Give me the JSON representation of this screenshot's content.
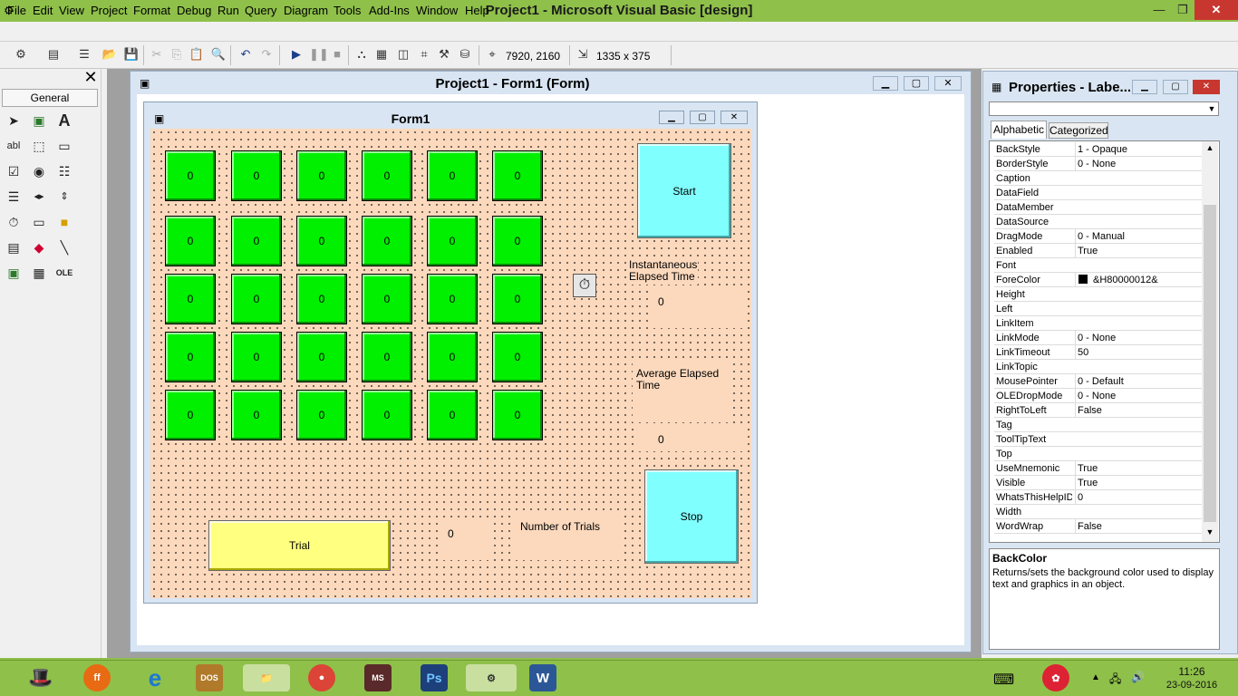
{
  "window": {
    "title": "Project1 - Microsoft Visual Basic [design]"
  },
  "menu": [
    "File",
    "Edit",
    "View",
    "Project",
    "Format",
    "Debug",
    "Run",
    "Query",
    "Diagram",
    "Tools",
    "Add-Ins",
    "Window",
    "Help"
  ],
  "toolbar": {
    "position_readout": "7920, 2160",
    "size_readout": "1335 x 375"
  },
  "toolbox": {
    "tab_label": "General"
  },
  "designer": {
    "title": "Project1 - Form1 (Form)"
  },
  "form": {
    "title": "Form1",
    "grid_value": "0",
    "start_label": "Start",
    "stop_label": "Stop",
    "trial_label": "Trial",
    "inst_label": "Instantaneous Elapsed Time",
    "inst_value": "0",
    "avg_label": "Average Elapsed Time",
    "avg_value": "0",
    "trials_label": "Number of Trials",
    "trials_value": "0"
  },
  "properties": {
    "title": "Properties - Labe...",
    "tab_alphabetic": "Alphabetic",
    "tab_categorized": "Categorized",
    "rows": [
      {
        "name": "BackStyle",
        "value": "1 - Opaque"
      },
      {
        "name": "BorderStyle",
        "value": "0 - None"
      },
      {
        "name": "Caption",
        "value": ""
      },
      {
        "name": "DataField",
        "value": ""
      },
      {
        "name": "DataMember",
        "value": ""
      },
      {
        "name": "DataSource",
        "value": ""
      },
      {
        "name": "DragMode",
        "value": "0 - Manual"
      },
      {
        "name": "Enabled",
        "value": "True"
      },
      {
        "name": "Font",
        "value": ""
      },
      {
        "name": "ForeColor",
        "value": "&H80000012&"
      },
      {
        "name": "Height",
        "value": ""
      },
      {
        "name": "Left",
        "value": ""
      },
      {
        "name": "LinkItem",
        "value": ""
      },
      {
        "name": "LinkMode",
        "value": "0 - None"
      },
      {
        "name": "LinkTimeout",
        "value": "50"
      },
      {
        "name": "LinkTopic",
        "value": ""
      },
      {
        "name": "MousePointer",
        "value": "0 - Default"
      },
      {
        "name": "OLEDropMode",
        "value": "0 - None"
      },
      {
        "name": "RightToLeft",
        "value": "False"
      },
      {
        "name": "Tag",
        "value": ""
      },
      {
        "name": "ToolTipText",
        "value": ""
      },
      {
        "name": "Top",
        "value": ""
      },
      {
        "name": "UseMnemonic",
        "value": "True"
      },
      {
        "name": "Visible",
        "value": "True"
      },
      {
        "name": "WhatsThisHelpID",
        "value": "0"
      },
      {
        "name": "Width",
        "value": ""
      },
      {
        "name": "WordWrap",
        "value": "False"
      }
    ],
    "desc_title": "BackColor",
    "desc_text": "Returns/sets the background color used to display text and graphics in an object."
  },
  "taskbar": {
    "time": "11:26",
    "date": "23-09-2016"
  },
  "colors": {
    "tile": "#00f000",
    "button": "#80ffff",
    "trial": "#ffff80",
    "canvas": "#fcd9bd"
  }
}
